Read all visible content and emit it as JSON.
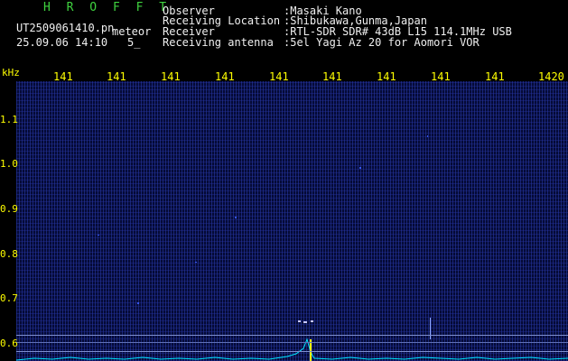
{
  "header": {
    "app_title": "H R O F F T",
    "filename": "UT2509061410.pn",
    "label_meteor": "meteor",
    "datetime": "25.09.06 14:10",
    "counter": "5_",
    "rows": [
      {
        "key": "Observer",
        "value": ":Masaki Kano"
      },
      {
        "key": "Receiving Location",
        "value": ":Shibukawa,Gunma,Japan"
      },
      {
        "key": "Receiver",
        "value": ":RTL-SDR SDR# 43dB L15 114.1MHz USB"
      },
      {
        "key": "Receiving antenna",
        "value": ":5el Yagi Az 20 for Aomori VOR"
      }
    ]
  },
  "axis": {
    "unit": "kHz",
    "x_ticks": [
      "141",
      "141",
      "141",
      "141",
      "141",
      "141",
      "141",
      "141",
      "141",
      "1420"
    ],
    "y_ticks": [
      "1.1",
      "1.0",
      "0.9",
      "0.8",
      "0.7",
      "0.6"
    ]
  },
  "colors": {
    "background": "#000000",
    "spectrogram": "#050a36",
    "tick_color": "#ffff00",
    "header_green": "#3fd23f",
    "signal": "#00ffff",
    "signal_hot": "#ffff00"
  }
}
